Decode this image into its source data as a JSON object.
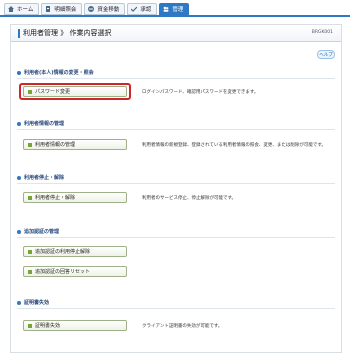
{
  "tabs": [
    {
      "label": "ホーム"
    },
    {
      "label": "明細照会"
    },
    {
      "label": "資金移動"
    },
    {
      "label": "承認"
    },
    {
      "label": "管理"
    }
  ],
  "header": {
    "title": "利用者管理 》 作業内容選択",
    "code": "BRGK001"
  },
  "help_label": "ヘルプ",
  "sections": {
    "s1": {
      "title": "利用者(本人)情報の変更・照会",
      "btn1": "パスワード変更",
      "desc1": "ログインパスワード、確認用パスワードを変更できます。"
    },
    "s2": {
      "title": "利用者情報の管理",
      "btn1": "利用者情報の管理",
      "desc1": "利用者情報の新規登録、登録されている利用者情報の照会、変更、または削除が可能です。"
    },
    "s3": {
      "title": "利用者停止・解除",
      "btn1": "利用者停止・解除",
      "desc1": "利用者のサービス停止、停止解除が可能です。"
    },
    "s4": {
      "title": "追加認証の管理",
      "btn1": "追加認証の利用停止解除",
      "btn2": "追加認証の回答リセット"
    },
    "s5": {
      "title": "証明書失効",
      "btn1": "証明書失効",
      "desc1": "クライアント証明書の失効が可能です。"
    }
  }
}
